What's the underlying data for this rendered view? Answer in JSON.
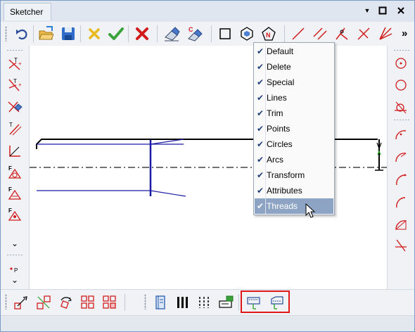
{
  "window": {
    "title": "Sketcher",
    "controls": {
      "dropdown": "▼",
      "maximize": "□",
      "close": "✕"
    }
  },
  "toolbar": {
    "overflow": "»",
    "icons": [
      "undo-icon",
      "open-folder-icon",
      "save-icon",
      "delete-yellow-x-icon",
      "confirm-check-icon",
      "cancel-red-x-icon",
      "eraser-icon",
      "eraser-c-icon",
      "rectangle-icon",
      "hexagon-icon",
      "pentagon-n-icon",
      "line-icon",
      "parallel-lines-icon",
      "angled-line-icon",
      "cross-lines-icon",
      "fan-lines-icon"
    ]
  },
  "left_toolbar": {
    "expand_glyph": "⌄",
    "icons": [
      "text-t-plus-icon",
      "text-t-plus-alt-icon",
      "eraser-cross-icon",
      "text-angled-icon",
      "angle-corner-icon",
      "dimension-f-icon",
      "dimension-f-alt-icon",
      "dimension-f-alt2-icon",
      "point-p-icon"
    ]
  },
  "right_toolbar": {
    "icons": [
      "circle-point-icon",
      "circle-icon",
      "tangent-circle-icon",
      "arc-icon",
      "arc-alt-icon",
      "arc-alt2-icon",
      "arc-open-icon",
      "arc-triangle-icon",
      "cross-angle-icon"
    ]
  },
  "bottom_toolbar": {
    "icons": [
      "move-icon",
      "mirror-icon",
      "rotate-icon",
      "pattern-grid-icon",
      "pattern-grid-alt-icon",
      "book-icon",
      "vertical-bars-icon",
      "vertical-dashed-bars-icon",
      "scale-box-icon",
      "thread-outer-icon",
      "thread-inner-icon"
    ]
  },
  "context_menu": {
    "check_glyph": "✔",
    "items": [
      {
        "label": "Default",
        "checked": true,
        "selected": false
      },
      {
        "label": "Delete",
        "checked": true,
        "selected": false
      },
      {
        "label": "Special",
        "checked": true,
        "selected": false
      },
      {
        "label": "Lines",
        "checked": true,
        "selected": false
      },
      {
        "label": "Trim",
        "checked": true,
        "selected": false
      },
      {
        "label": "Points",
        "checked": true,
        "selected": false
      },
      {
        "label": "Circles",
        "checked": true,
        "selected": false
      },
      {
        "label": "Arcs",
        "checked": true,
        "selected": false
      },
      {
        "label": "Transform",
        "checked": true,
        "selected": false
      },
      {
        "label": "Attributes",
        "checked": true,
        "selected": false
      },
      {
        "label": "Threads",
        "checked": true,
        "selected": true
      }
    ]
  },
  "colors": {
    "sketch_black": "#000000",
    "sketch_blue": "#1a1aa6",
    "icon_red": "#d11c1c",
    "highlight_red": "#e01818",
    "menu_selected": "#8ea4c4"
  }
}
